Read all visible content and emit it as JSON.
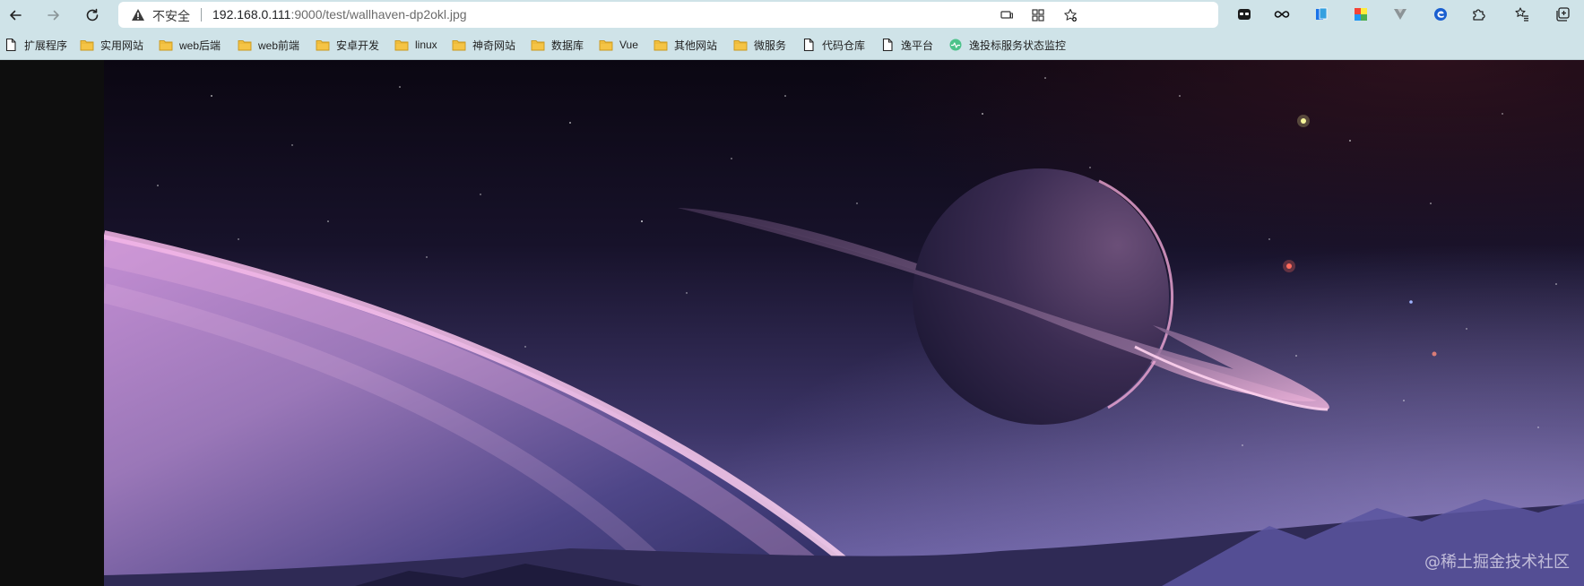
{
  "browser": {
    "security_label": "不安全",
    "url_host": "192.168.0.111",
    "url_path": ":9000/test/wallhaven-dp2okl.jpg"
  },
  "bookmarks": [
    {
      "label": "扩展程序",
      "icon": "page-icon"
    },
    {
      "label": "实用网站",
      "icon": "folder-icon"
    },
    {
      "label": "web后端",
      "icon": "folder-icon"
    },
    {
      "label": "web前端",
      "icon": "folder-icon"
    },
    {
      "label": "安卓开发",
      "icon": "folder-icon"
    },
    {
      "label": "linux",
      "icon": "folder-icon"
    },
    {
      "label": "神奇网站",
      "icon": "folder-icon"
    },
    {
      "label": "数据库",
      "icon": "folder-icon"
    },
    {
      "label": "Vue",
      "icon": "folder-icon"
    },
    {
      "label": "其他网站",
      "icon": "folder-icon"
    },
    {
      "label": "微服务",
      "icon": "folder-icon"
    },
    {
      "label": "代码仓库",
      "icon": "page-icon"
    },
    {
      "label": "逸平台",
      "icon": "page-icon"
    },
    {
      "label": "逸投标服务状态监控",
      "icon": "pulse-icon"
    }
  ],
  "viewer": {
    "watermark": "@稀土掘金技术社区"
  },
  "colors": {
    "toolbar_bg": "#cfe3e8",
    "folder": "#f5c445",
    "sky_dark": "#0b0712",
    "planet_pink": "#e6a3d6"
  }
}
